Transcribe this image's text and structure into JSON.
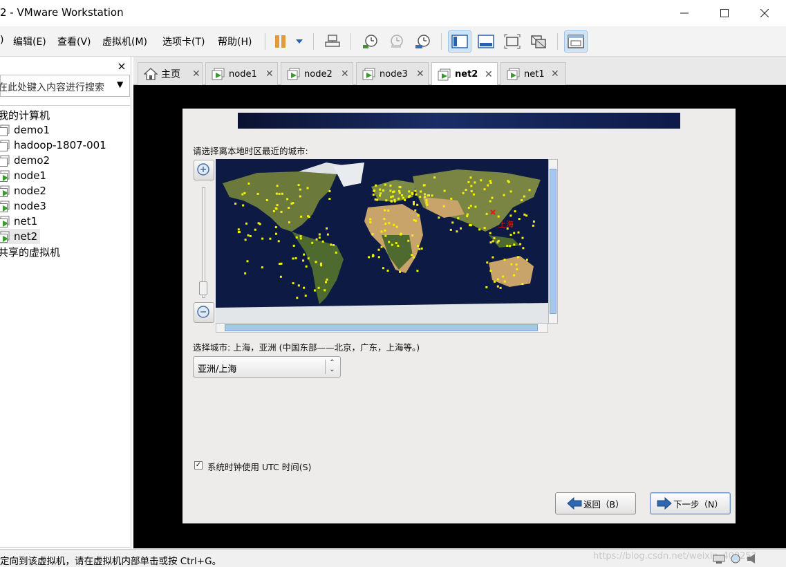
{
  "window": {
    "title": "2 - VMware Workstation"
  },
  "menu": {
    "items": [
      ")",
      "编辑(E)",
      "查看(V)",
      "虚拟机(M)",
      "选项卡(T)",
      "帮助(H)"
    ]
  },
  "toolbar": {
    "icons": [
      "pause-icon",
      "dropdown-icon",
      "send-ctrl-alt-del-icon",
      "snapshot-take-icon",
      "snapshot-revert-icon",
      "snapshot-manager-icon",
      "view-console-icon",
      "view-fullscreen-strip-icon",
      "fit-window-icon",
      "unity-icon",
      "thumbnail-icon"
    ]
  },
  "library": {
    "close": "×",
    "search_placeholder": "在此处键入内容进行搜索",
    "tree": {
      "my_computer": "我的计算机",
      "vms": [
        "demo1",
        "hadoop-1807-001",
        "demo2",
        "node1",
        "node2",
        "node3",
        "net1",
        "net2"
      ],
      "shared": "共享的虚拟机"
    }
  },
  "tabs": [
    {
      "label": "主页",
      "icon": "home-icon"
    },
    {
      "label": "node1",
      "icon": "vm-icon"
    },
    {
      "label": "node2",
      "icon": "vm-icon"
    },
    {
      "label": "node3",
      "icon": "vm-icon"
    },
    {
      "label": "net2",
      "icon": "vm-icon",
      "selected": true
    },
    {
      "label": "net1",
      "icon": "vm-icon"
    }
  ],
  "installer": {
    "prompt": "请选择离本地时区最近的城市:",
    "map_city_label": "上海",
    "selected_city_text": "选择城市: 上海，亚洲 (中国东部——北京，广东，上海等。)",
    "timezone_value": "亚洲/上海",
    "utc_checkbox_label": "系统时钟使用 UTC 时间(S)",
    "utc_checked": true,
    "back_button": "返回（B）",
    "next_button": "下一步（N）"
  },
  "statusbar": {
    "text": "定向到该虚拟机，请在虚拟机内部单击或按 Ctrl+G。",
    "watermark": "https://blog.csdn.net/weixin_40025?"
  },
  "colors": {
    "map_ocean": "#0d1a44",
    "city_dot": "#f2f200",
    "selected_city": "#e01818",
    "scroll_thumb": "#a6c6ea"
  }
}
